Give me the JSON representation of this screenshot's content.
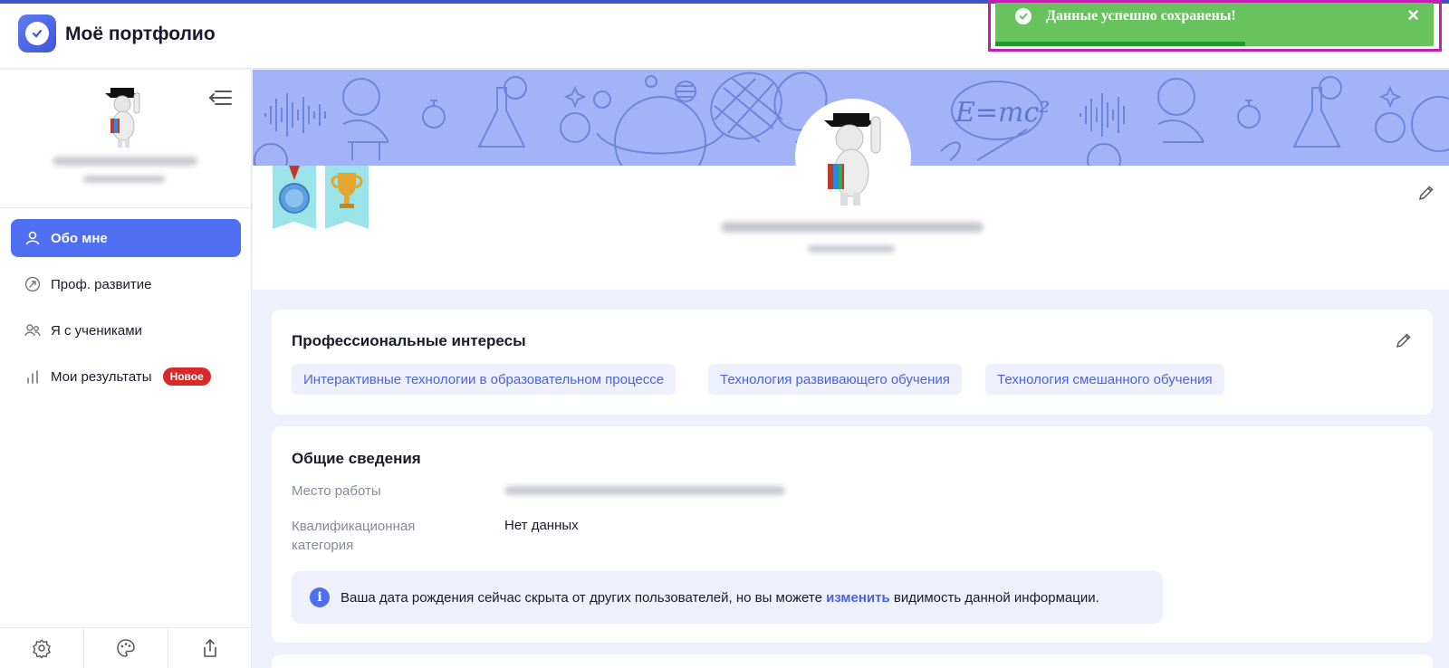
{
  "header": {
    "title": "Моё портфолио"
  },
  "toast": {
    "message": "Данные успешно сохранены!",
    "close_icon": "×",
    "progress": 0.57,
    "color": "#68c35e"
  },
  "sidebar": {
    "items": [
      {
        "label": "Обо мне",
        "icon": "user-icon",
        "active": true
      },
      {
        "label": "Проф. развитие",
        "icon": "growth-icon"
      },
      {
        "label": "Я с учениками",
        "icon": "students-icon"
      },
      {
        "label": "Мои результаты",
        "icon": "chart-icon",
        "badge": "Новое"
      }
    ],
    "footer_icons": [
      "gear-icon",
      "palette-icon",
      "share-icon"
    ]
  },
  "interests": {
    "title": "Профессиональные интересы",
    "tags": [
      "Интерактивные технологии в образовательном процессе",
      "Технология развивающего обучения",
      "Технология смешанного обучения"
    ]
  },
  "general": {
    "title": "Общие сведения",
    "workplace_label": "Место работы",
    "category_label_1": "Квалификационная",
    "category_label_2": "категория",
    "category_value": "Нет данных",
    "info_before": "Ваша дата рождения сейчас скрыта от других пользователей, но вы можете ",
    "info_link": "изменить",
    "info_after": " видимость данной информации."
  },
  "banner": {
    "formula": "E=mc²",
    "color": "#a2b4f7"
  },
  "colors": {
    "accent": "#4e6ff2",
    "badge": "#d92a2a",
    "highlight": "#c21fb0"
  }
}
